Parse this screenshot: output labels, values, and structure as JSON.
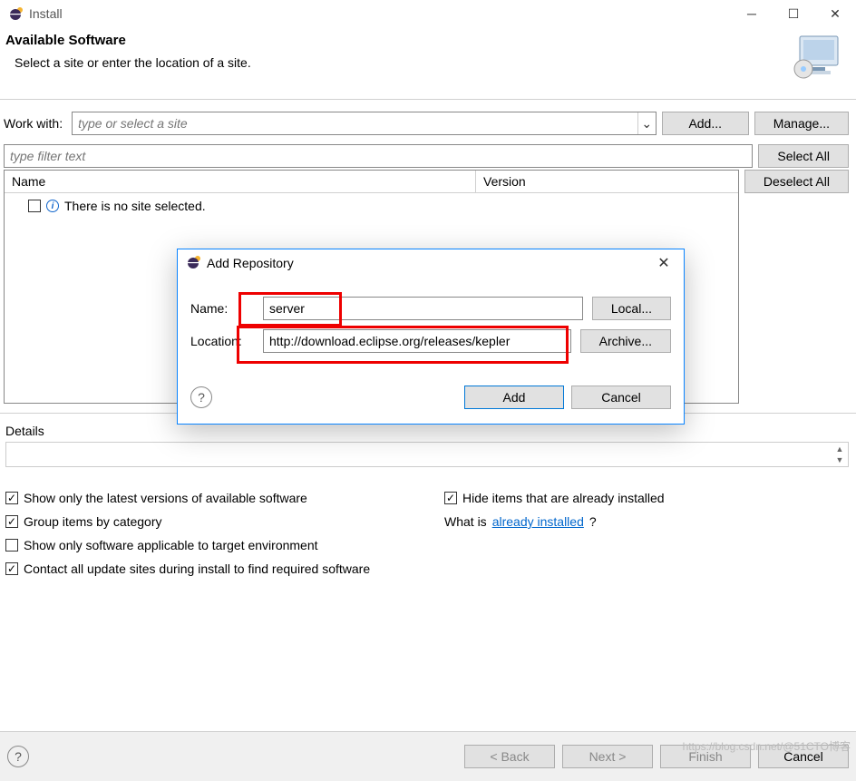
{
  "titlebar": {
    "title": "Install"
  },
  "header": {
    "title": "Available Software",
    "subtitle": "Select a site or enter the location of a site."
  },
  "workwith": {
    "label": "Work with:",
    "placeholder": "type or select a site",
    "add": "Add...",
    "manage": "Manage..."
  },
  "filter": {
    "placeholder": "type filter text",
    "select_all": "Select All",
    "deselect_all": "Deselect All"
  },
  "table": {
    "col_name": "Name",
    "col_version": "Version",
    "empty_msg": "There is no site selected."
  },
  "details": {
    "label": "Details"
  },
  "checks": {
    "latest": "Show only the latest versions of available software",
    "hide_installed": "Hide items that are already installed",
    "group_cat": "Group items by category",
    "whatis_prefix": "What is ",
    "whatis_link": "already installed",
    "whatis_suffix": "?",
    "applicable": "Show only software applicable to target environment",
    "contact": "Contact all update sites during install to find required software"
  },
  "wizard": {
    "back": "< Back",
    "next": "Next >",
    "finish": "Finish",
    "cancel": "Cancel"
  },
  "dialog": {
    "title": "Add Repository",
    "name_label": "Name:",
    "name_value": "server",
    "loc_label": "Location:",
    "loc_value": "http://download.eclipse.org/releases/kepler",
    "local": "Local...",
    "archive": "Archive...",
    "add": "Add",
    "cancel": "Cancel"
  },
  "watermark": "https://blog.csdn.net/@51CTO博客"
}
